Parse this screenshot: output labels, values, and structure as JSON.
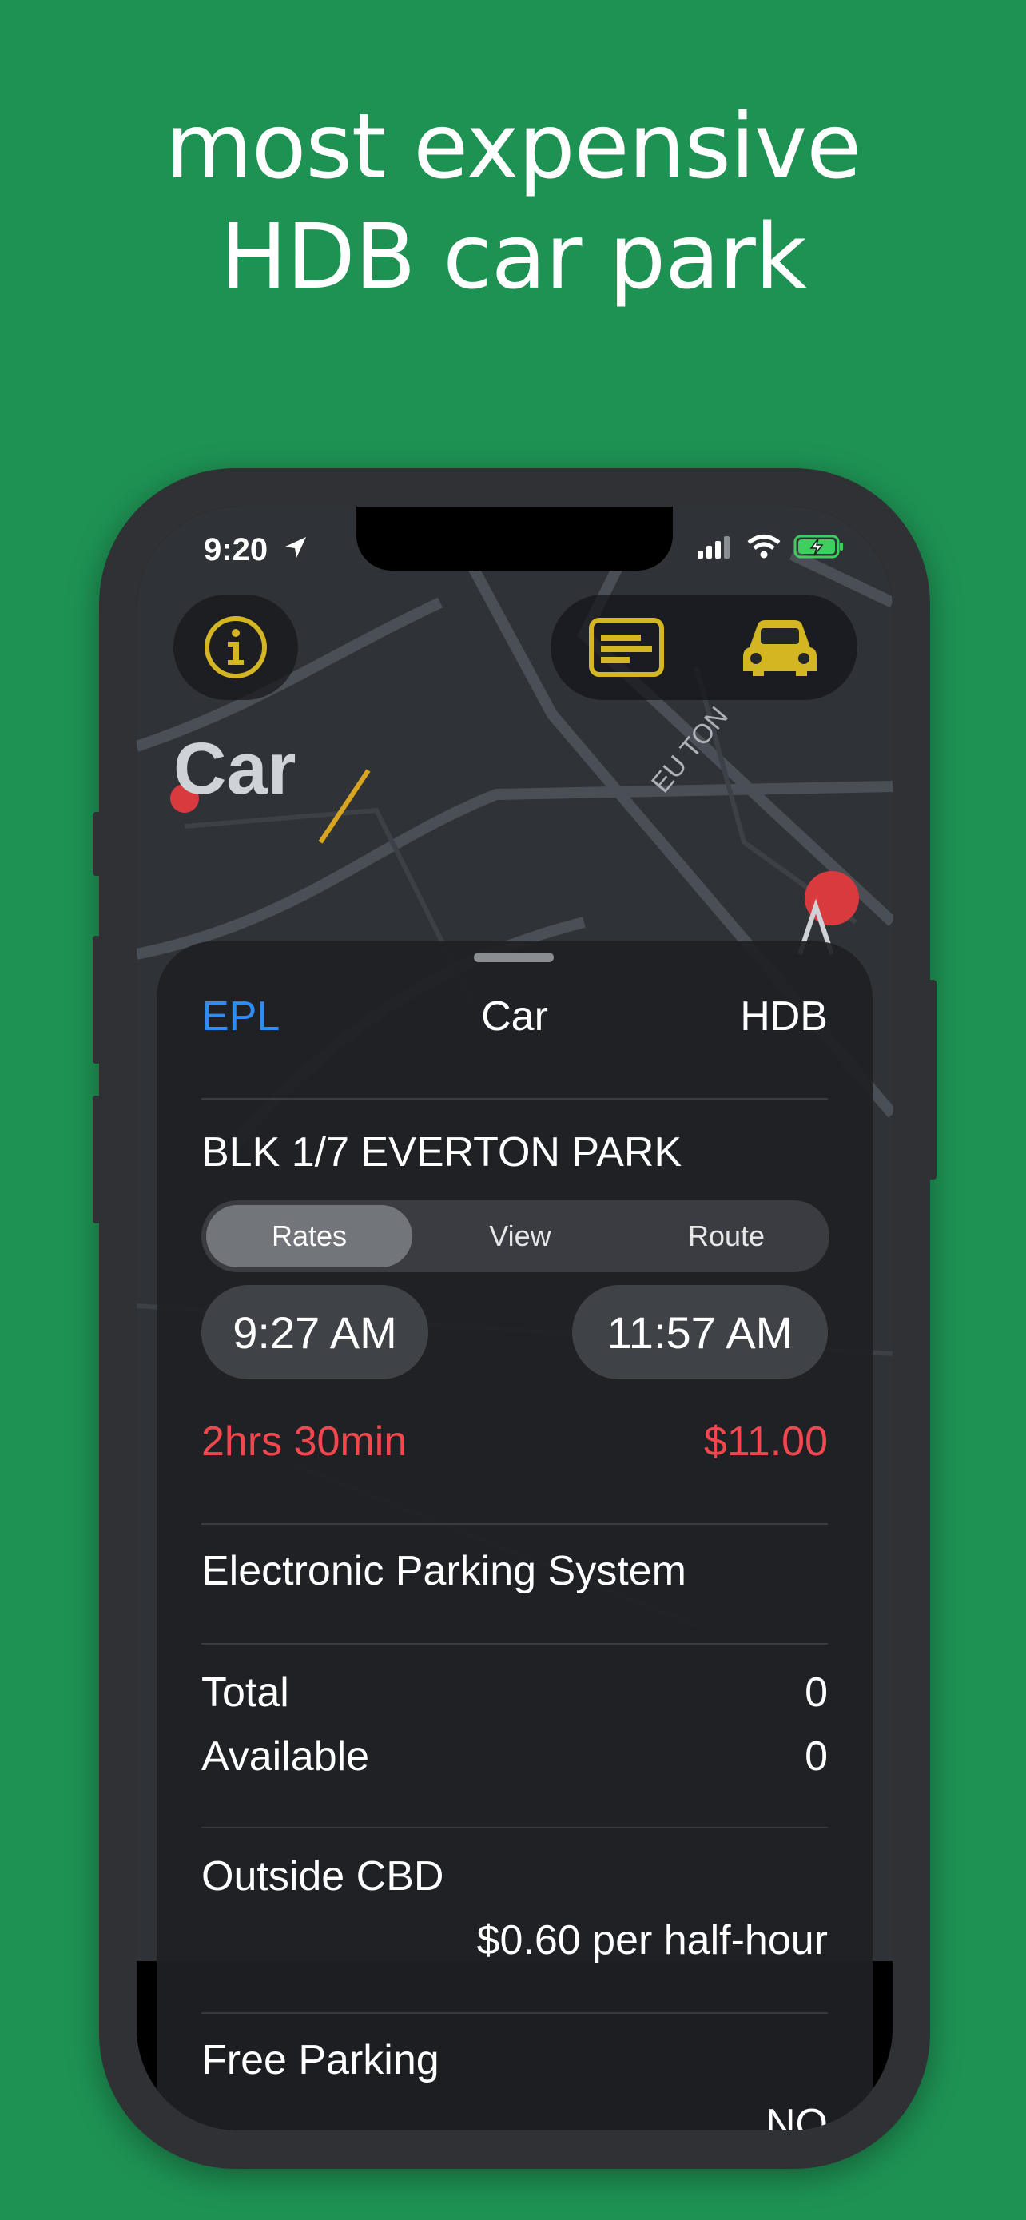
{
  "headline": {
    "line1": "most expensive",
    "line2": "HDB car park"
  },
  "status_bar": {
    "time": "9:20"
  },
  "map": {
    "label": "Car",
    "icons": [
      "info-icon",
      "card-icon",
      "car-icon"
    ]
  },
  "sheet": {
    "left_tab": "EPL",
    "title": "Car",
    "right_tab": "HDB",
    "carpark_name": "BLK 1/7 EVERTON PARK",
    "segments": [
      "Rates",
      "View",
      "Route"
    ],
    "active_segment": "Rates",
    "start_time": "9:27 AM",
    "end_time": "11:57 AM",
    "duration": "2hrs 30min",
    "cost": "$11.00",
    "system_type": "Electronic Parking System",
    "total_label": "Total",
    "total_value": "0",
    "available_label": "Available",
    "available_value": "0",
    "zone": "Outside CBD",
    "rate": "$0.60 per half-hour",
    "free_parking_label": "Free Parking",
    "free_parking_value": "NO"
  },
  "colors": {
    "background": "#1e9253",
    "accent_blue": "#2f8cf5",
    "alert_red": "#f0484e",
    "icon_yellow": "#d4b522"
  }
}
